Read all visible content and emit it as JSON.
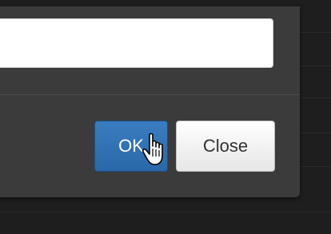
{
  "dialog": {
    "input_value": "",
    "ok_label": "OK",
    "close_label": "Close"
  },
  "colors": {
    "ok_button": "#2f72b5",
    "close_button": "#f2f2f2",
    "dialog_background": "#3b3b3b",
    "page_background": "#1e1e1e"
  },
  "cursor": {
    "icon": "hand-pointer-icon"
  }
}
